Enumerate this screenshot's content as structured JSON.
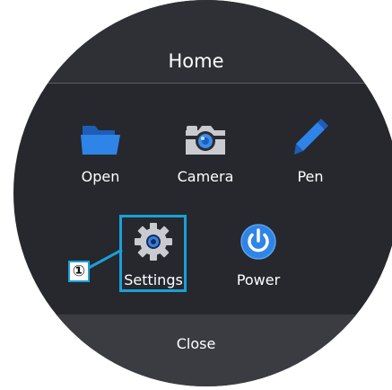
{
  "header": {
    "title": "Home"
  },
  "menu": {
    "items": [
      {
        "label": "Open",
        "icon": "folder-icon"
      },
      {
        "label": "Camera",
        "icon": "camera-icon"
      },
      {
        "label": "Pen",
        "icon": "pen-icon"
      },
      {
        "label": "Settings",
        "icon": "gear-icon"
      },
      {
        "label": "Power",
        "icon": "power-icon"
      }
    ]
  },
  "footer": {
    "close_label": "Close"
  },
  "annotation": {
    "callout_number": "①"
  },
  "colors": {
    "accent": "#1aa0da",
    "icon_blue": "#2f7ee0",
    "background": "#26282d",
    "header": "#2e3036",
    "footer": "#3a3c42"
  }
}
